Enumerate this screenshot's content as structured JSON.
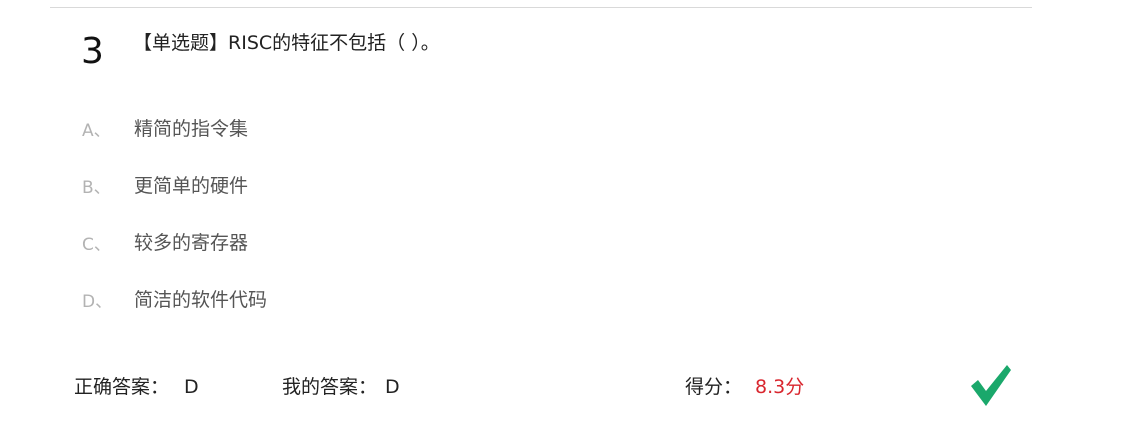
{
  "question": {
    "number": "3",
    "type_tag": "【单选题】",
    "text": "RISC的特征不包括（ ）。"
  },
  "options": [
    {
      "letter": "A、",
      "text": "精简的指令集"
    },
    {
      "letter": "B、",
      "text": "更简单的硬件"
    },
    {
      "letter": "C、",
      "text": "较多的寄存器"
    },
    {
      "letter": "D、",
      "text": "简洁的软件代码"
    }
  ],
  "answer": {
    "correct_label": "正确答案：",
    "correct_value": "D",
    "mine_label": "我的答案：",
    "mine_value": "D",
    "score_label": "得分：",
    "score_value": "8.3分"
  },
  "colors": {
    "score": "#d9262e",
    "check": "#1aa86b"
  },
  "icons": {
    "result": "check-icon"
  }
}
